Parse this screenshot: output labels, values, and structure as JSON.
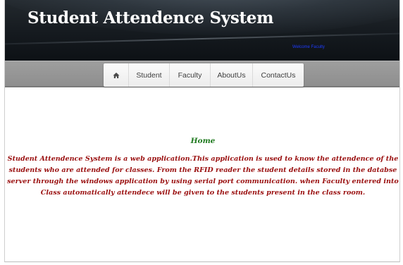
{
  "header": {
    "title": "Student Attendence System",
    "link_text": "Welcome Faculty"
  },
  "nav": {
    "home_icon": "home-icon",
    "items": [
      "Student",
      "Faculty",
      "AboutUs",
      "ContactUs"
    ]
  },
  "main": {
    "heading": "Home",
    "description": "Student Attendence System is a web application.This application is used to know the attendence of the students who are attended for classes. From the RFID reader the student details stored in the databse server through the windows application by using serial port communication. when Faculty entered into Class automatically attendece will be given to the students present in the class room."
  },
  "colors": {
    "header_bg": "#151a1f",
    "navbar_bg": "#9a9a9a",
    "heading_green": "#1f7a1f",
    "text_red": "#9a1010",
    "link_blue": "#1e3cff"
  }
}
